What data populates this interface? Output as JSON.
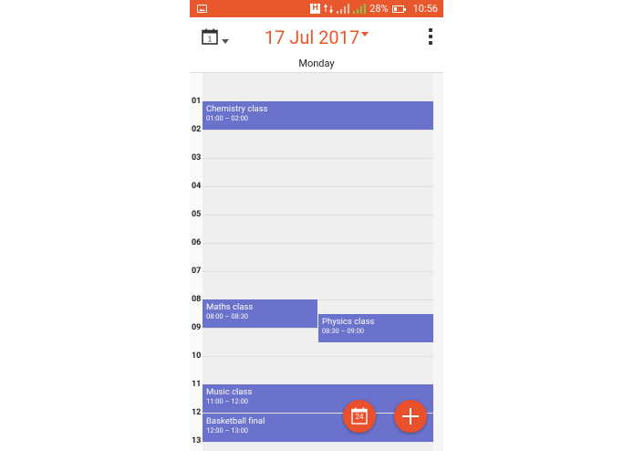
{
  "status_bar": {
    "network_badge": "H",
    "battery_percent": "28%",
    "time": "10:56"
  },
  "toolbar": {
    "date_title": "17 Jul 2017",
    "calendar_icon_day": "1"
  },
  "day_header": {
    "day_name": "Monday"
  },
  "hours": [
    "01",
    "02",
    "03",
    "04",
    "05",
    "06",
    "07",
    "08",
    "09",
    "10",
    "11",
    "12",
    "13"
  ],
  "events": [
    {
      "title": "Chemistry class",
      "time": "01:00 – 02:00"
    },
    {
      "title": "Maths class",
      "time": "08:00 – 08:30"
    },
    {
      "title": "Physics class",
      "time": "08:30 – 09:00"
    },
    {
      "title": "Music class",
      "time": "11:00 – 12:00"
    },
    {
      "title": "Basketball final",
      "time": "12:00 – 13:00"
    }
  ],
  "fab_today": {
    "day_number": "24"
  },
  "colors": {
    "accent": "#e9572c",
    "event": "#6b72cb",
    "fab": "#e9502b"
  }
}
